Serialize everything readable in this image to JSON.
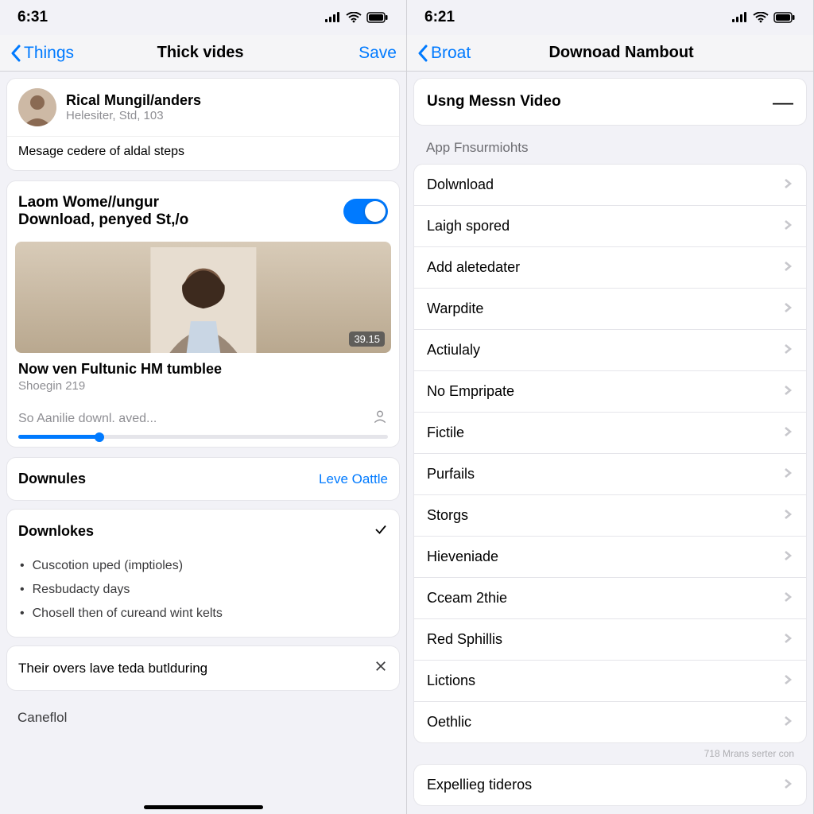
{
  "left": {
    "status_time": "6:31",
    "nav_back": "Things",
    "nav_title": "Thick vides",
    "nav_save": "Save",
    "profile": {
      "name": "Rical Mungil/anders",
      "sub": "Helesiter, Std, 103"
    },
    "profile_msg": "Mesage cedere of aldal steps",
    "toggle": {
      "line1": "Laom Wome//ungur",
      "line2": "Download, penyed St,/o"
    },
    "video": {
      "title": "Now ven Fultunic HM tumblee",
      "sub": "Shoegin 219",
      "duration": "39.15"
    },
    "progress_label": "So Aanilie downl. aved...",
    "downules": {
      "label": "Downules",
      "link": "Leve Oattle"
    },
    "downlokes": {
      "label": "Downlokes",
      "items": [
        "Cuscotion uped (imptioles)",
        "Resbudacty days",
        "Chosell then of cureand wint kelts"
      ]
    },
    "overs": "Their overs lave teda butlduring",
    "caneflol": "Caneflol"
  },
  "right": {
    "status_time": "6:21",
    "nav_back": "Broat",
    "nav_title": "Downoad Nambout",
    "collapse": "Usng Messn Video",
    "group": "App Fnsurmiohts",
    "menu": [
      "Dolwnload",
      "Laigh spored",
      "Add aletedater",
      "Warpdite",
      "Actiulaly",
      "No Empripate",
      "Fictile",
      "Purfails",
      "Storgs",
      "Hieveniade",
      "Cceam 2thie",
      "Red Sphillis",
      "Lictions",
      "Oethlic"
    ],
    "tiny": "718 Mrans serter con",
    "menu2_first": "Expellieg tideros"
  }
}
